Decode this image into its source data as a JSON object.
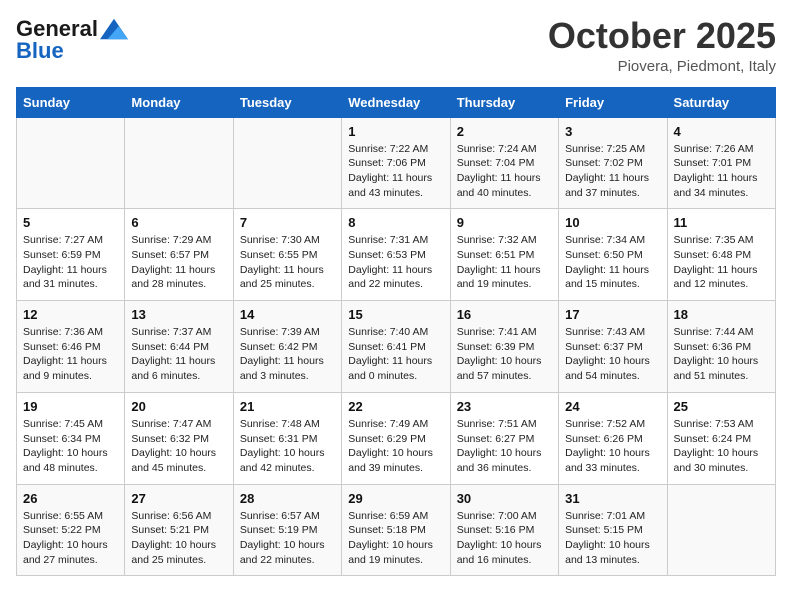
{
  "header": {
    "logo_general": "General",
    "logo_blue": "Blue",
    "month_title": "October 2025",
    "location": "Piovera, Piedmont, Italy"
  },
  "days_of_week": [
    "Sunday",
    "Monday",
    "Tuesday",
    "Wednesday",
    "Thursday",
    "Friday",
    "Saturday"
  ],
  "weeks": [
    [
      {
        "day": "",
        "info": ""
      },
      {
        "day": "",
        "info": ""
      },
      {
        "day": "",
        "info": ""
      },
      {
        "day": "1",
        "info": "Sunrise: 7:22 AM\nSunset: 7:06 PM\nDaylight: 11 hours and 43 minutes."
      },
      {
        "day": "2",
        "info": "Sunrise: 7:24 AM\nSunset: 7:04 PM\nDaylight: 11 hours and 40 minutes."
      },
      {
        "day": "3",
        "info": "Sunrise: 7:25 AM\nSunset: 7:02 PM\nDaylight: 11 hours and 37 minutes."
      },
      {
        "day": "4",
        "info": "Sunrise: 7:26 AM\nSunset: 7:01 PM\nDaylight: 11 hours and 34 minutes."
      }
    ],
    [
      {
        "day": "5",
        "info": "Sunrise: 7:27 AM\nSunset: 6:59 PM\nDaylight: 11 hours and 31 minutes."
      },
      {
        "day": "6",
        "info": "Sunrise: 7:29 AM\nSunset: 6:57 PM\nDaylight: 11 hours and 28 minutes."
      },
      {
        "day": "7",
        "info": "Sunrise: 7:30 AM\nSunset: 6:55 PM\nDaylight: 11 hours and 25 minutes."
      },
      {
        "day": "8",
        "info": "Sunrise: 7:31 AM\nSunset: 6:53 PM\nDaylight: 11 hours and 22 minutes."
      },
      {
        "day": "9",
        "info": "Sunrise: 7:32 AM\nSunset: 6:51 PM\nDaylight: 11 hours and 19 minutes."
      },
      {
        "day": "10",
        "info": "Sunrise: 7:34 AM\nSunset: 6:50 PM\nDaylight: 11 hours and 15 minutes."
      },
      {
        "day": "11",
        "info": "Sunrise: 7:35 AM\nSunset: 6:48 PM\nDaylight: 11 hours and 12 minutes."
      }
    ],
    [
      {
        "day": "12",
        "info": "Sunrise: 7:36 AM\nSunset: 6:46 PM\nDaylight: 11 hours and 9 minutes."
      },
      {
        "day": "13",
        "info": "Sunrise: 7:37 AM\nSunset: 6:44 PM\nDaylight: 11 hours and 6 minutes."
      },
      {
        "day": "14",
        "info": "Sunrise: 7:39 AM\nSunset: 6:42 PM\nDaylight: 11 hours and 3 minutes."
      },
      {
        "day": "15",
        "info": "Sunrise: 7:40 AM\nSunset: 6:41 PM\nDaylight: 11 hours and 0 minutes."
      },
      {
        "day": "16",
        "info": "Sunrise: 7:41 AM\nSunset: 6:39 PM\nDaylight: 10 hours and 57 minutes."
      },
      {
        "day": "17",
        "info": "Sunrise: 7:43 AM\nSunset: 6:37 PM\nDaylight: 10 hours and 54 minutes."
      },
      {
        "day": "18",
        "info": "Sunrise: 7:44 AM\nSunset: 6:36 PM\nDaylight: 10 hours and 51 minutes."
      }
    ],
    [
      {
        "day": "19",
        "info": "Sunrise: 7:45 AM\nSunset: 6:34 PM\nDaylight: 10 hours and 48 minutes."
      },
      {
        "day": "20",
        "info": "Sunrise: 7:47 AM\nSunset: 6:32 PM\nDaylight: 10 hours and 45 minutes."
      },
      {
        "day": "21",
        "info": "Sunrise: 7:48 AM\nSunset: 6:31 PM\nDaylight: 10 hours and 42 minutes."
      },
      {
        "day": "22",
        "info": "Sunrise: 7:49 AM\nSunset: 6:29 PM\nDaylight: 10 hours and 39 minutes."
      },
      {
        "day": "23",
        "info": "Sunrise: 7:51 AM\nSunset: 6:27 PM\nDaylight: 10 hours and 36 minutes."
      },
      {
        "day": "24",
        "info": "Sunrise: 7:52 AM\nSunset: 6:26 PM\nDaylight: 10 hours and 33 minutes."
      },
      {
        "day": "25",
        "info": "Sunrise: 7:53 AM\nSunset: 6:24 PM\nDaylight: 10 hours and 30 minutes."
      }
    ],
    [
      {
        "day": "26",
        "info": "Sunrise: 6:55 AM\nSunset: 5:22 PM\nDaylight: 10 hours and 27 minutes."
      },
      {
        "day": "27",
        "info": "Sunrise: 6:56 AM\nSunset: 5:21 PM\nDaylight: 10 hours and 25 minutes."
      },
      {
        "day": "28",
        "info": "Sunrise: 6:57 AM\nSunset: 5:19 PM\nDaylight: 10 hours and 22 minutes."
      },
      {
        "day": "29",
        "info": "Sunrise: 6:59 AM\nSunset: 5:18 PM\nDaylight: 10 hours and 19 minutes."
      },
      {
        "day": "30",
        "info": "Sunrise: 7:00 AM\nSunset: 5:16 PM\nDaylight: 10 hours and 16 minutes."
      },
      {
        "day": "31",
        "info": "Sunrise: 7:01 AM\nSunset: 5:15 PM\nDaylight: 10 hours and 13 minutes."
      },
      {
        "day": "",
        "info": ""
      }
    ]
  ]
}
